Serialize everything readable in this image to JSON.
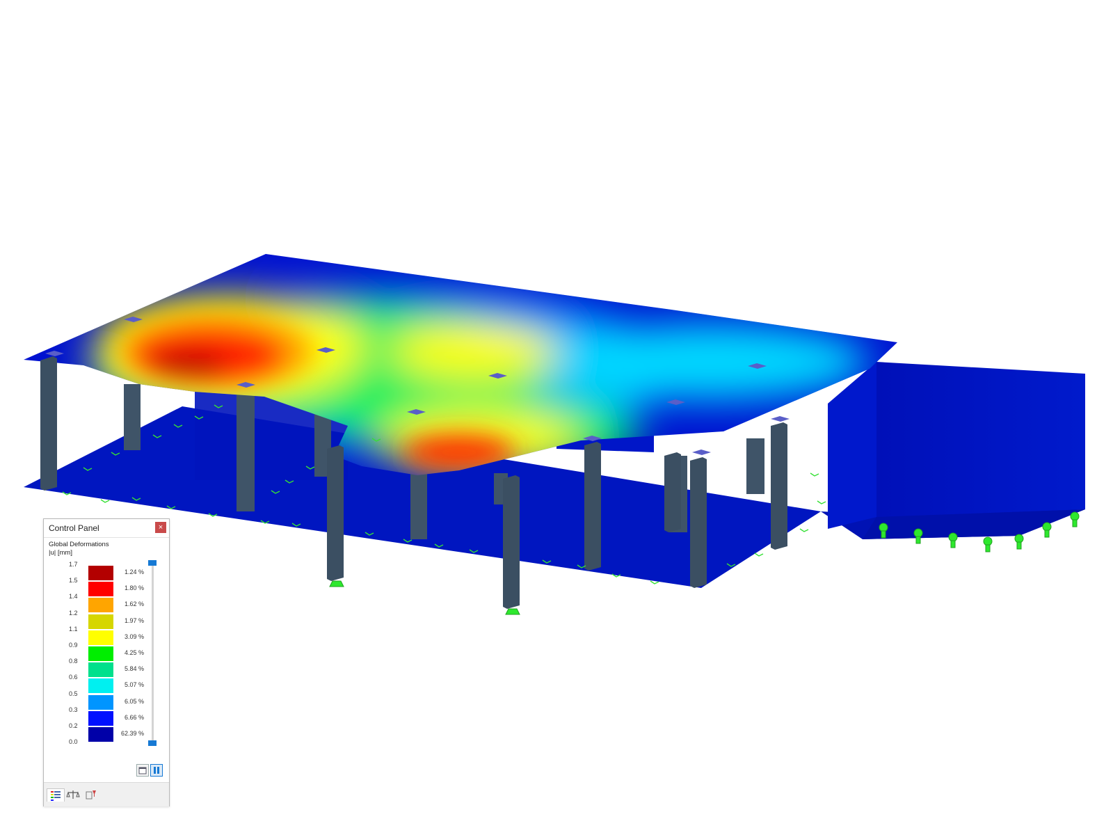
{
  "control_panel": {
    "title": "Control Panel",
    "close_label": "×",
    "result_type": "Global Deformations",
    "unit_label": "|u| [mm]",
    "legend": {
      "ticks": [
        "1.7",
        "1.5",
        "1.4",
        "1.2",
        "1.1",
        "0.9",
        "0.8",
        "0.6",
        "0.5",
        "0.3",
        "0.2",
        "0.0"
      ],
      "bands": [
        {
          "color": "#b30000",
          "percent": "1.24 %"
        },
        {
          "color": "#ff0000",
          "percent": "1.80 %"
        },
        {
          "color": "#ffa500",
          "percent": "1.62 %"
        },
        {
          "color": "#d6d600",
          "percent": "1.97 %"
        },
        {
          "color": "#ffff00",
          "percent": "3.09 %"
        },
        {
          "color": "#00ee00",
          "percent": "4.25 %"
        },
        {
          "color": "#00e08c",
          "percent": "5.84 %"
        },
        {
          "color": "#00f0f0",
          "percent": "5.07 %"
        },
        {
          "color": "#0095ff",
          "percent": "6.05 %"
        },
        {
          "color": "#0010ff",
          "percent": "6.66 %"
        },
        {
          "color": "#0000a8",
          "percent": "62.39 %"
        }
      ]
    },
    "tabs": [
      {
        "icon": "color-scale-icon"
      },
      {
        "icon": "balance-icon"
      },
      {
        "icon": "filter-icon"
      }
    ],
    "buttons": {
      "settings_icon": "legend-settings-icon",
      "adjust_icon": "legend-adjust-icon"
    }
  },
  "model": {
    "description_colors": {
      "column": "#3b4f62",
      "slab_base": "#0014c8",
      "support": "#22ee22"
    }
  }
}
